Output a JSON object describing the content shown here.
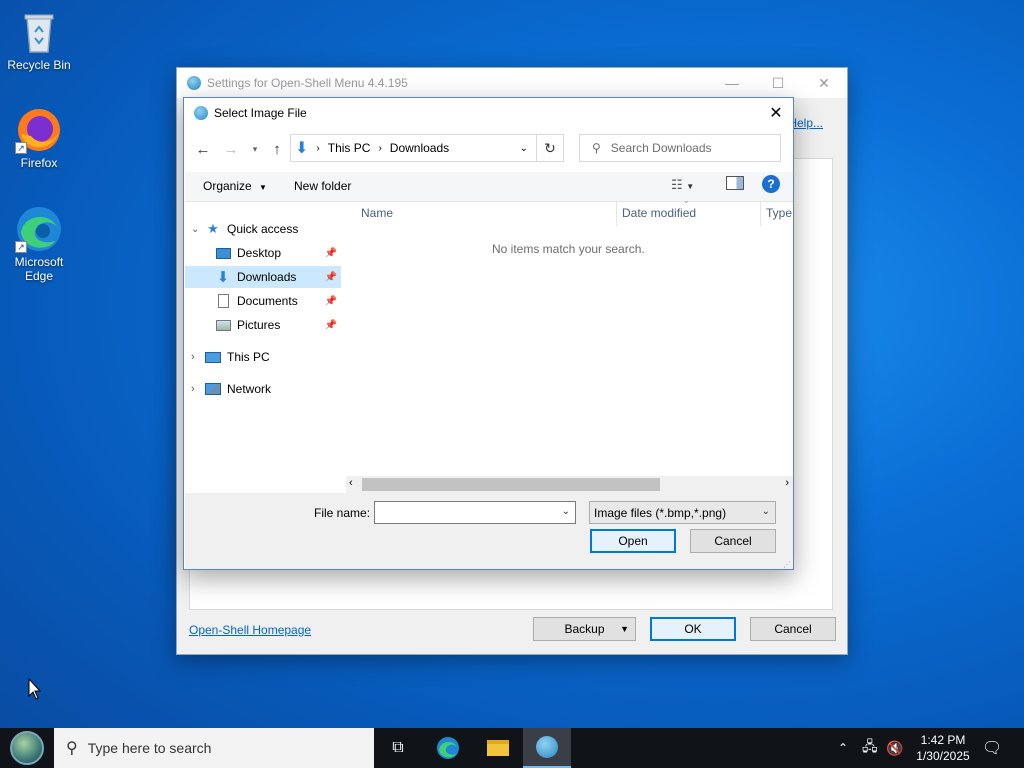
{
  "desktop": {
    "icons": [
      {
        "label": "Recycle Bin"
      },
      {
        "label": "Firefox"
      },
      {
        "label": "Microsoft\nEdge"
      }
    ]
  },
  "settings_window": {
    "title": "Settings for Open-Shell Menu 4.4.195",
    "help_link": "Help...",
    "homepage_link": "Open-Shell Homepage",
    "backup_label": "Backup",
    "ok_label": "OK",
    "cancel_label": "Cancel"
  },
  "dialog": {
    "title": "Select Image File",
    "address": {
      "crumbs": [
        "This PC",
        "Downloads"
      ]
    },
    "search_placeholder": "Search Downloads",
    "toolbar": {
      "organize": "Organize",
      "new_folder": "New folder"
    },
    "nav": {
      "quick_access": "Quick access",
      "items": [
        {
          "label": "Desktop",
          "icon": "desktop-icon"
        },
        {
          "label": "Downloads",
          "icon": "downloads-icon",
          "selected": true
        },
        {
          "label": "Documents",
          "icon": "documents-icon"
        },
        {
          "label": "Pictures",
          "icon": "pictures-icon"
        }
      ],
      "this_pc": "This PC",
      "network": "Network"
    },
    "columns": [
      "Name",
      "Date modified",
      "Type"
    ],
    "empty_message": "No items match your search.",
    "file_name_label": "File name:",
    "file_name_value": "",
    "filter_value": "Image files (*.bmp,*.png)",
    "open_label": "Open",
    "cancel_label": "Cancel"
  },
  "taskbar": {
    "search_placeholder": "Type here to search",
    "clock_time": "1:42 PM",
    "clock_date": "1/30/2025"
  },
  "colors": {
    "desktop_blue": "#0a6fd6",
    "accent": "#0078d7",
    "selection": "#cce8ff",
    "link": "#0066cc"
  }
}
